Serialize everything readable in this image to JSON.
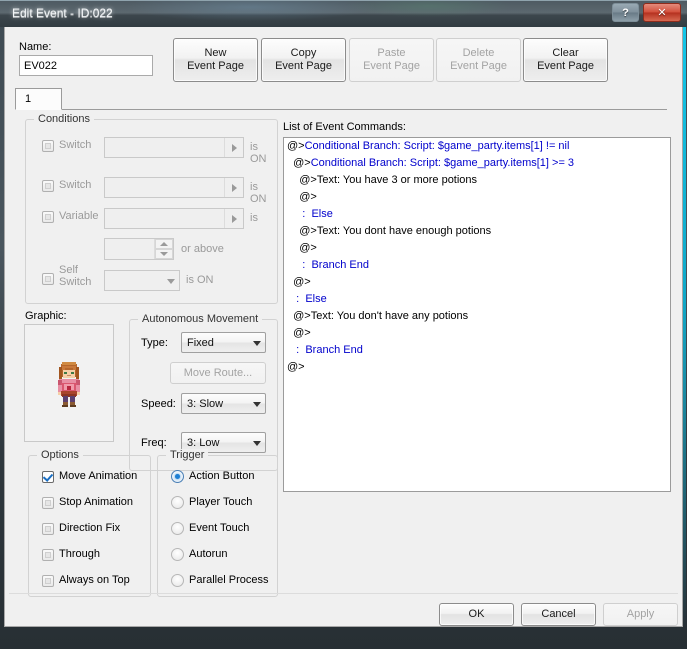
{
  "window": {
    "title": "Edit Event - ID:022",
    "help_button": "?",
    "close_button": "✕"
  },
  "header": {
    "name_label": "Name:",
    "name_value": "EV022",
    "page_buttons": [
      {
        "line1": "New",
        "line2": "Event Page",
        "enabled": true
      },
      {
        "line1": "Copy",
        "line2": "Event Page",
        "enabled": true
      },
      {
        "line1": "Paste",
        "line2": "Event Page",
        "enabled": false
      },
      {
        "line1": "Delete",
        "line2": "Event Page",
        "enabled": false
      },
      {
        "line1": "Clear",
        "line2": "Event Page",
        "enabled": true
      }
    ]
  },
  "tabs": [
    {
      "label": "1",
      "selected": true
    }
  ],
  "conditions": {
    "title": "Conditions",
    "switch1": {
      "label": "Switch",
      "checked": false,
      "value": "",
      "suffix": "is ON"
    },
    "switch2": {
      "label": "Switch",
      "checked": false,
      "value": "",
      "suffix": "is ON"
    },
    "variable": {
      "label": "Variable",
      "checked": false,
      "value": "",
      "suffix": "is"
    },
    "variable_number": {
      "value": "",
      "suffix": "or above"
    },
    "self_switch": {
      "label_line1": "Self",
      "label_line2": "Switch",
      "checked": false,
      "value": "",
      "suffix": "is ON"
    }
  },
  "graphic": {
    "label": "Graphic:",
    "sprite_name": "character-sprite"
  },
  "movement": {
    "title": "Autonomous Movement",
    "type_label": "Type:",
    "type_value": "Fixed",
    "move_route_button": "Move Route...",
    "speed_label": "Speed:",
    "speed_value": "3: Slow",
    "freq_label": "Freq:",
    "freq_value": "3: Low"
  },
  "options": {
    "title": "Options",
    "items": [
      {
        "label": "Move Animation",
        "checked": true
      },
      {
        "label": "Stop Animation",
        "checked": false
      },
      {
        "label": "Direction Fix",
        "checked": false
      },
      {
        "label": "Through",
        "checked": false
      },
      {
        "label": "Always on Top",
        "checked": false
      }
    ]
  },
  "trigger": {
    "title": "Trigger",
    "items": [
      {
        "label": "Action Button",
        "selected": true
      },
      {
        "label": "Player Touch",
        "selected": false
      },
      {
        "label": "Event Touch",
        "selected": false
      },
      {
        "label": "Autorun",
        "selected": false
      },
      {
        "label": "Parallel Process",
        "selected": false
      }
    ]
  },
  "command_list": {
    "label": "List of Event Commands:",
    "lines": [
      {
        "indent": 0,
        "marker": "@>",
        "text": "Conditional Branch: Script: $game_party.items[1] != nil",
        "blue": true
      },
      {
        "indent": 1,
        "marker": "@>",
        "text": "Conditional Branch: Script: $game_party.items[1] >= 3",
        "blue": true
      },
      {
        "indent": 2,
        "marker": "@>",
        "text": "Text: You have 3 or more potions",
        "blue": false
      },
      {
        "indent": 2,
        "marker": "@>",
        "text": "",
        "blue": false
      },
      {
        "indent": 2,
        "marker": ":",
        "text": "Else",
        "blue": true
      },
      {
        "indent": 2,
        "marker": "@>",
        "text": "Text: You dont have enough potions",
        "blue": false
      },
      {
        "indent": 2,
        "marker": "@>",
        "text": "",
        "blue": false
      },
      {
        "indent": 2,
        "marker": ":",
        "text": "Branch End",
        "blue": true
      },
      {
        "indent": 1,
        "marker": "@>",
        "text": "",
        "blue": false
      },
      {
        "indent": 1,
        "marker": ":",
        "text": "Else",
        "blue": true
      },
      {
        "indent": 1,
        "marker": "@>",
        "text": "Text: You don't have any potions",
        "blue": false
      },
      {
        "indent": 1,
        "marker": "@>",
        "text": "",
        "blue": false
      },
      {
        "indent": 1,
        "marker": ":",
        "text": "Branch End",
        "blue": true
      },
      {
        "indent": 0,
        "marker": "@>",
        "text": "",
        "blue": false
      }
    ]
  },
  "footer": {
    "ok": "OK",
    "cancel": "Cancel",
    "apply": "Apply",
    "apply_enabled": false
  },
  "colors": {
    "command_blue": "#0000cc",
    "accent_cyan": "#13c6e8",
    "close_red": "#d2503c"
  }
}
